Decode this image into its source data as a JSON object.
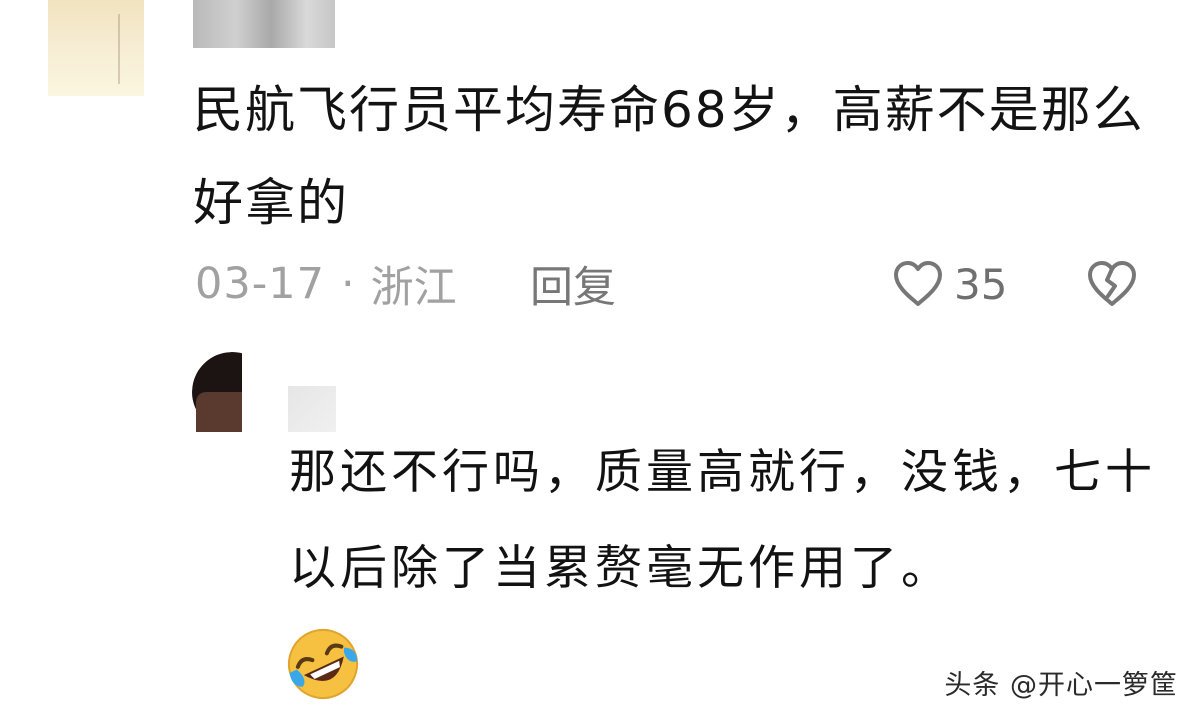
{
  "comment": {
    "text": "民航飞行员平均寿命68岁，高薪不是那么好拿的",
    "date": "03-17",
    "separator": "·",
    "location": "浙江",
    "reply_label": "回复",
    "like_count": "35"
  },
  "reply": {
    "text": "那还不行吗，质量高就行，没钱，七十以后除了当累赘毫无作用了。"
  },
  "watermark": "头条 @开心一箩筐",
  "colors": {
    "meta_gray": "#a1a1a1",
    "icon_gray": "#777777",
    "emoji_yellow": "#f6c141",
    "tear_blue": "#3aa8e8"
  },
  "icons": {
    "like": "heart-outline-icon",
    "dislike": "broken-heart-icon",
    "emoji": "rolling-laughing-emoji"
  }
}
